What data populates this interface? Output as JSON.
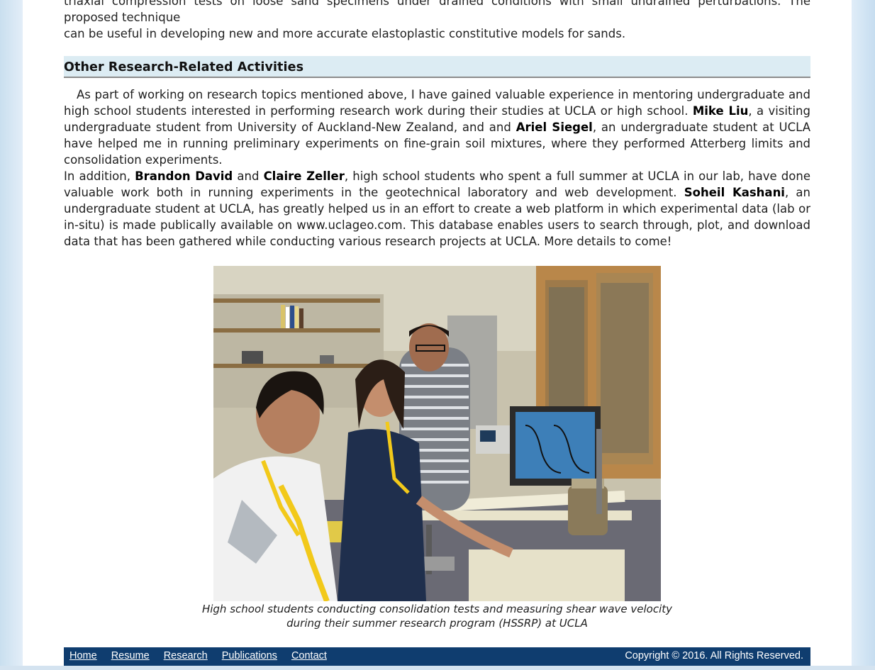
{
  "intro": {
    "line1": "triaxial compression tests on loose sand specimens under drained conditions with small undrained perturbations. The proposed technique",
    "line2": "can be useful in developing new and more accurate elastoplastic constitutive models for sands."
  },
  "section": {
    "heading": "Other Research-Related Activities"
  },
  "paragraph1": {
    "t1": "As part of working on research topics mentioned above, I have gained valuable experience in mentoring undergraduate and high school students interested in performing research work during their studies at UCLA or high school. ",
    "b1": "Mike Liu",
    "t2": ", a visiting undergraduate student from University of Auckland-New Zealand, and and ",
    "b2": "Ariel Siegel",
    "t3": ", an undergraduate student at UCLA have helped me in running preliminary experiments on fine-grain soil mixtures, where they performed Atterberg limits and consolidation experiments."
  },
  "paragraph2": {
    "t1": "In addition, ",
    "b1": "Brandon David",
    "t2": " and ",
    "b2": "Claire Zeller",
    "t3": ", high school students who spent a full summer at UCLA in our lab, have done valuable work both in running experiments in the geotechnical laboratory and web development. ",
    "b3": "Soheil Kashani",
    "t4": ", an undergraduate student at UCLA, has greatly helped us in an effort to create a web platform in which experimental data (lab or in-situ) is made publically available on www.uclageo.com. This database enables users to search through, plot, and download data that has been gathered while conducting various research projects at UCLA. More details to come!"
  },
  "figure": {
    "caption_line1": "High school students conducting consolidation tests and measuring shear wave velocity",
    "caption_line2": "during their summer research program (HSSRP) at UCLA"
  },
  "footer": {
    "nav": [
      "Home",
      "Resume",
      "Research",
      "Publications",
      "Contact"
    ],
    "copyright": "Copyright © 2016. All Rights Reserved."
  },
  "colors": {
    "heading_band": "#dcecf3",
    "footer_bg": "#0f3d6f",
    "side_background": "#c9dfef"
  }
}
